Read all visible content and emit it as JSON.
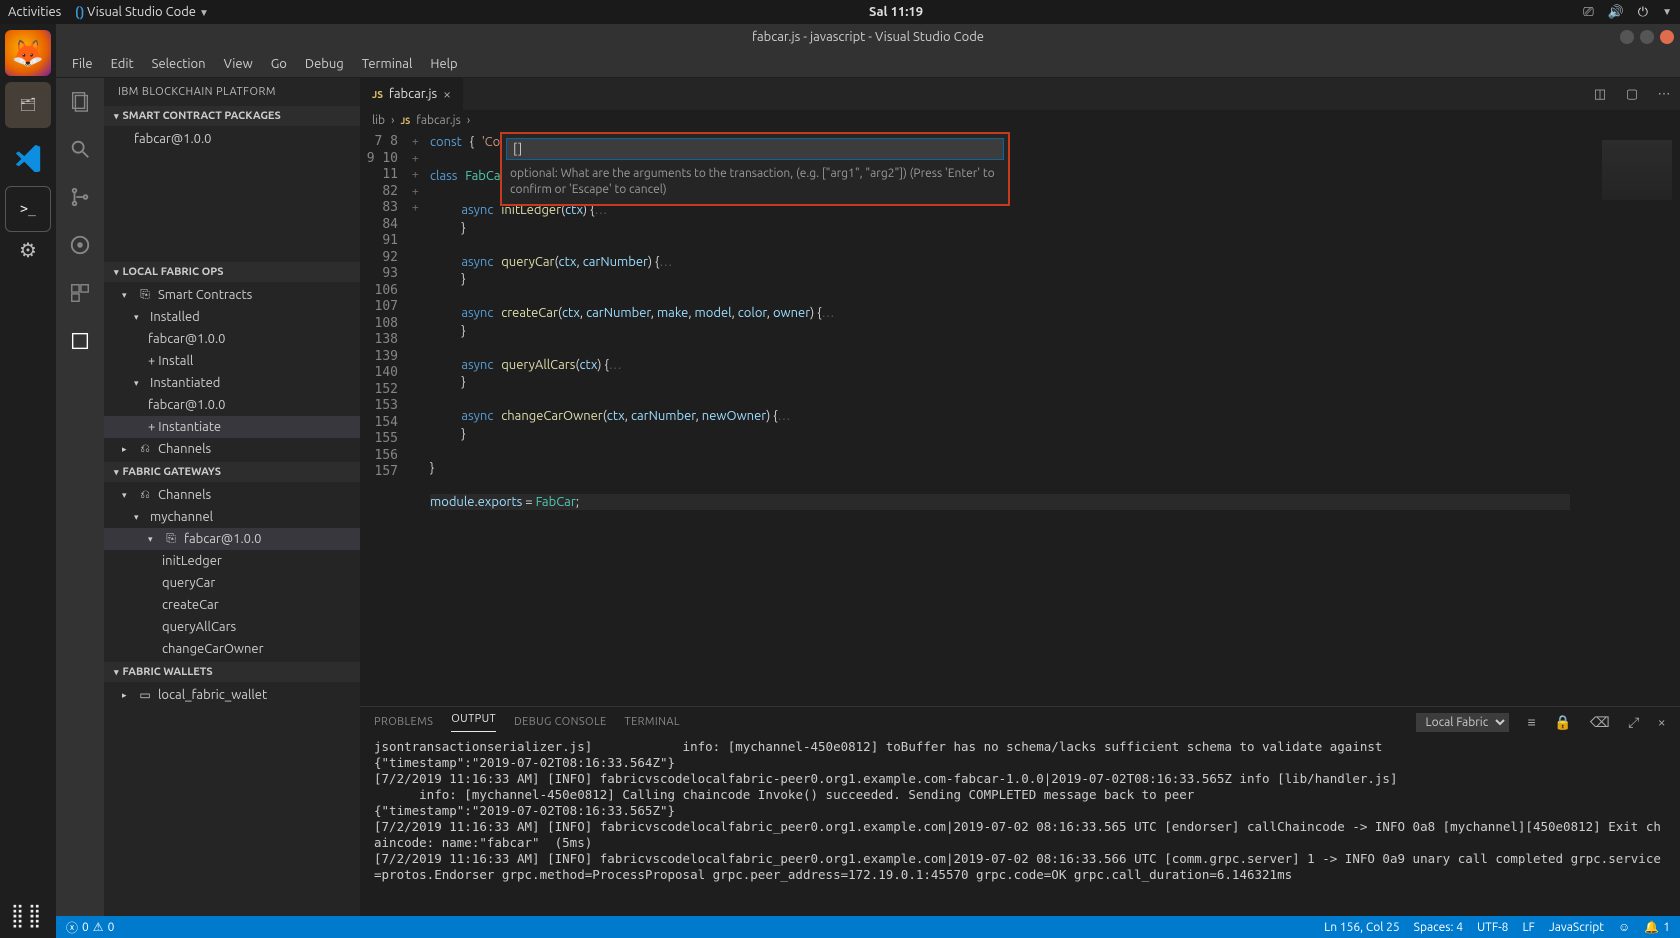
{
  "topbar": {
    "activities": "Activities",
    "app_indicator": "Visual Studio Code",
    "clock": "Sal 11:19"
  },
  "title": "fabcar.js - javascript - Visual Studio Code",
  "menu": [
    "File",
    "Edit",
    "Selection",
    "View",
    "Go",
    "Debug",
    "Terminal",
    "Help"
  ],
  "sidepanel": {
    "title": "IBM BLOCKCHAIN PLATFORM",
    "sections": {
      "packages": {
        "title": "SMART CONTRACT PACKAGES",
        "items": [
          "fabcar@1.0.0"
        ]
      },
      "local_ops": {
        "title": "LOCAL FABRIC OPS",
        "smart_contracts": {
          "label": "Smart Contracts",
          "installed": {
            "label": "Installed",
            "items": [
              "fabcar@1.0.0",
              "+ Install"
            ]
          },
          "instantiated": {
            "label": "Instantiated",
            "items": [
              "fabcar@1.0.0",
              "+ Instantiate"
            ]
          }
        },
        "channels": {
          "label": "Channels"
        }
      },
      "gateways": {
        "title": "FABRIC GATEWAYS",
        "channels": "Channels",
        "mychannel": "mychannel",
        "contract": "fabcar@1.0.0",
        "functions": [
          "initLedger",
          "queryCar",
          "createCar",
          "queryAllCars",
          "changeCarOwner"
        ]
      },
      "wallets": {
        "title": "FABRIC WALLETS",
        "items": [
          "local_fabric_wallet"
        ]
      }
    }
  },
  "tab": {
    "name": "fabcar.js"
  },
  "breadcrumbs": [
    "lib",
    "fabcar.js"
  ],
  "quickinput": {
    "value": "[]",
    "hint": "optional: What are the arguments to the transaction, (e.g. [\"arg1\", \"arg2\"]) (Press 'Enter' to confirm or 'Escape' to cancel)"
  },
  "gutter_numbers": [
    "7",
    "8",
    "9",
    "10",
    "11",
    "82",
    "83",
    "84",
    "91",
    "92",
    "93",
    "106",
    "107",
    "108",
    "138",
    "139",
    "140",
    "152",
    "153",
    "154",
    "155",
    "156",
    "157"
  ],
  "fold_marks": {
    "11": "+",
    "84": "+",
    "93": "+",
    "108": "+",
    "140": "+"
  },
  "code_lines": [
    {
      "html": "<span class='k'>const</span> <span class='p'>{</span> <span class='s'>'Co…'</span>"
    },
    {
      "html": ""
    },
    {
      "html": "<span class='k'>class</span> <span class='cls'>FabCar</span> <span class='k'>extends</span> <span class='cls'>Contract</span> <span class='p'>{</span>"
    },
    {
      "html": ""
    },
    {
      "html": "    <span class='k'>async</span> <span class='fn'>initLedger</span><span class='p'>(</span><span class='v'>ctx</span><span class='p'>) {</span><span class='dots'>…</span>"
    },
    {
      "html": "    <span class='p'>}</span>"
    },
    {
      "html": ""
    },
    {
      "html": "    <span class='k'>async</span> <span class='fn'>queryCar</span><span class='p'>(</span><span class='v'>ctx</span><span class='p'>, </span><span class='v'>carNumber</span><span class='p'>) {</span><span class='dots'>…</span>"
    },
    {
      "html": "    <span class='p'>}</span>"
    },
    {
      "html": ""
    },
    {
      "html": "    <span class='k'>async</span> <span class='fn'>createCar</span><span class='p'>(</span><span class='v'>ctx</span><span class='p'>, </span><span class='v'>carNumber</span><span class='p'>, </span><span class='v'>make</span><span class='p'>, </span><span class='v'>model</span><span class='p'>, </span><span class='v'>color</span><span class='p'>, </span><span class='v'>owner</span><span class='p'>) {</span><span class='dots'>…</span>"
    },
    {
      "html": "    <span class='p'>}</span>"
    },
    {
      "html": ""
    },
    {
      "html": "    <span class='k'>async</span> <span class='fn'>queryAllCars</span><span class='p'>(</span><span class='v'>ctx</span><span class='p'>) {</span><span class='dots'>…</span>"
    },
    {
      "html": "    <span class='p'>}</span>"
    },
    {
      "html": ""
    },
    {
      "html": "    <span class='k'>async</span> <span class='fn'>changeCarOwner</span><span class='p'>(</span><span class='v'>ctx</span><span class='p'>, </span><span class='v'>carNumber</span><span class='p'>, </span><span class='v'>newOwner</span><span class='p'>) {</span><span class='dots'>…</span>"
    },
    {
      "html": "    <span class='p'>}</span>"
    },
    {
      "html": ""
    },
    {
      "html": "<span class='p'>}</span>"
    },
    {
      "html": ""
    },
    {
      "hl": true,
      "html": "<span class='v'>module</span><span class='p'>.</span><span class='v'>exports</span> <span class='p'>=</span> <span class='cls'>FabCar</span><span class='p'>;</span>"
    },
    {
      "html": ""
    }
  ],
  "panel": {
    "tabs": [
      "PROBLEMS",
      "OUTPUT",
      "DEBUG CONSOLE",
      "TERMINAL"
    ],
    "active": "OUTPUT",
    "selector": "Local Fabric",
    "output": "jsontransactionserializer.js]            info: [mychannel-450e0812] toBuffer has no schema/lacks sufficient schema to validate against\n{\"timestamp\":\"2019-07-02T08:16:33.564Z\"}\n[7/2/2019 11:16:33 AM] [INFO] fabricvscodelocalfabric-peer0.org1.example.com-fabcar-1.0.0|2019-07-02T08:16:33.565Z info [lib/handler.js]\n      info: [mychannel-450e0812] Calling chaincode Invoke() succeeded. Sending COMPLETED message back to peer\n{\"timestamp\":\"2019-07-02T08:16:33.565Z\"}\n[7/2/2019 11:16:33 AM] [INFO] fabricvscodelocalfabric_peer0.org1.example.com|2019-07-02 08:16:33.565 UTC [endorser] callChaincode -> INFO 0a8 [mychannel][450e0812] Exit chaincode: name:\"fabcar\"  (5ms)\n[7/2/2019 11:16:33 AM] [INFO] fabricvscodelocalfabric_peer0.org1.example.com|2019-07-02 08:16:33.566 UTC [comm.grpc.server] 1 -> INFO 0a9 unary call completed grpc.service=protos.Endorser grpc.method=ProcessProposal grpc.peer_address=172.19.0.1:45570 grpc.code=OK grpc.call_duration=6.146321ms"
  },
  "status": {
    "errors": "0",
    "warnings": "0",
    "ln_col": "Ln 156, Col 25",
    "spaces": "Spaces: 4",
    "encoding": "UTF-8",
    "eol": "LF",
    "lang": "JavaScript",
    "bell": "1"
  }
}
